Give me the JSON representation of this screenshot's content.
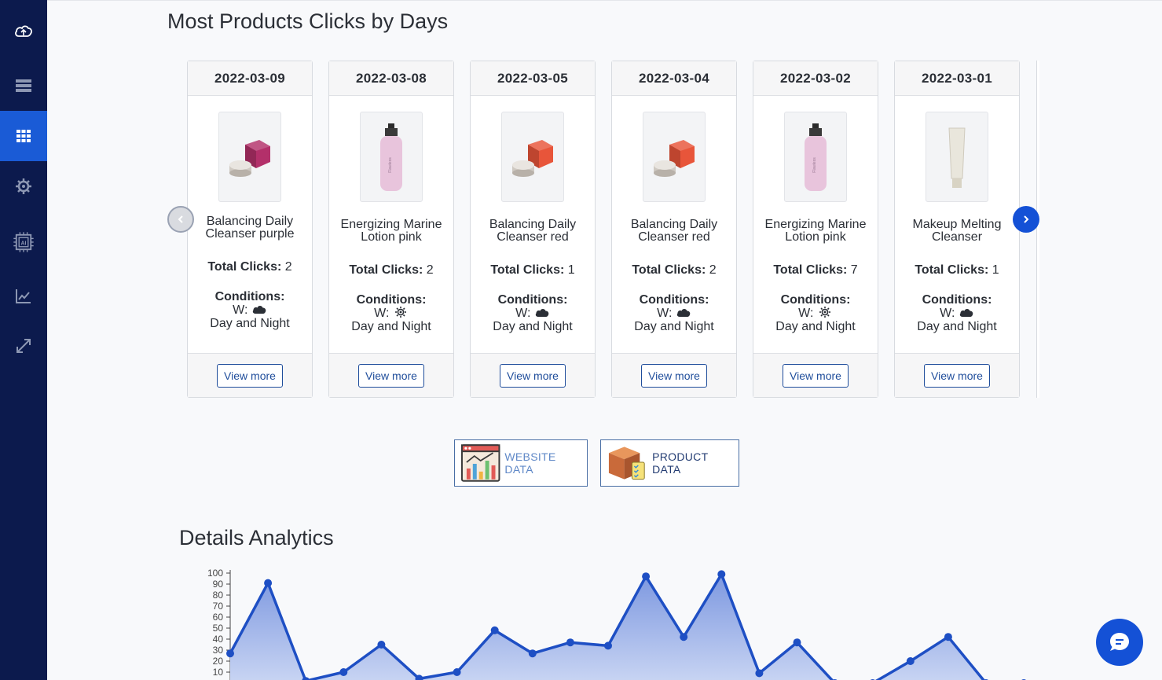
{
  "sections": {
    "clicks_title": "Most Products Clicks by Days",
    "analytics_title": "Details Analytics"
  },
  "sidebar": {
    "items": [
      {
        "icon": "cloud-upload-icon",
        "active": false
      },
      {
        "icon": "server-icon",
        "active": false
      },
      {
        "icon": "grid-icon",
        "active": true
      },
      {
        "icon": "gear-icon",
        "active": false
      },
      {
        "icon": "ai-chip-icon",
        "active": false
      },
      {
        "icon": "chart-line-icon",
        "active": false
      },
      {
        "icon": "expand-icon",
        "active": false
      }
    ]
  },
  "cards": [
    {
      "date": "2022-03-09",
      "name": "Balancing Daily Cleanser purple",
      "clicks_label": "Total Clicks:",
      "clicks": "2",
      "conditions_label": "Conditions:",
      "weather_label": "W:",
      "weather_icon": "cloud-icon",
      "time": "Day and Night",
      "button": "View more",
      "product_color": "#b3306a"
    },
    {
      "date": "2022-03-08",
      "name": "Energizing Marine Lotion pink",
      "clicks_label": "Total Clicks:",
      "clicks": "2",
      "conditions_label": "Conditions:",
      "weather_label": "W:",
      "weather_icon": "sun-icon",
      "time": "Day and Night",
      "button": "View more",
      "product_color": "#e8c4dc"
    },
    {
      "date": "2022-03-05",
      "name": "Balancing Daily Cleanser red",
      "clicks_label": "Total Clicks:",
      "clicks": "1",
      "conditions_label": "Conditions:",
      "weather_label": "W:",
      "weather_icon": "cloud-icon",
      "time": "Day and Night",
      "button": "View more",
      "product_color": "#e8553a"
    },
    {
      "date": "2022-03-04",
      "name": "Balancing Daily Cleanser red",
      "clicks_label": "Total Clicks:",
      "clicks": "2",
      "conditions_label": "Conditions:",
      "weather_label": "W:",
      "weather_icon": "cloud-icon",
      "time": "Day and Night",
      "button": "View more",
      "product_color": "#e8553a"
    },
    {
      "date": "2022-03-02",
      "name": "Energizing Marine Lotion pink",
      "clicks_label": "Total Clicks:",
      "clicks": "7",
      "conditions_label": "Conditions:",
      "weather_label": "W:",
      "weather_icon": "sun-icon",
      "time": "Day and Night",
      "button": "View more",
      "product_color": "#e8c4dc"
    },
    {
      "date": "2022-03-01",
      "name": "Makeup Melting Cleanser",
      "clicks_label": "Total Clicks:",
      "clicks": "1",
      "conditions_label": "Conditions:",
      "weather_label": "W:",
      "weather_icon": "cloud-icon",
      "time": "Day and Night",
      "button": "View more",
      "product_color": "#e9e6dc"
    }
  ],
  "tiles": {
    "website": "WEBSITE DATA",
    "product": "PRODUCT DATA"
  },
  "chart_data": {
    "type": "area",
    "title": "",
    "xlabel": "",
    "ylabel": "",
    "ylim": [
      0,
      100
    ],
    "yticks": [
      10,
      20,
      30,
      40,
      50,
      60,
      70,
      80,
      90,
      100
    ],
    "series": [
      {
        "values": [
          27,
          91,
          2,
          10,
          35,
          4,
          10,
          48,
          27,
          37,
          34,
          97,
          42,
          99,
          9,
          37,
          0,
          0,
          20,
          42,
          0,
          0
        ]
      }
    ],
    "colors": {
      "line": "#1e4fc4",
      "fill_top": "#7d98e0",
      "fill_bottom": "#c9d5f3"
    }
  },
  "colors": {
    "sidebar_bg": "#0c1a4d",
    "sidebar_active": "#1a5bd6",
    "accent": "#1451d6"
  }
}
